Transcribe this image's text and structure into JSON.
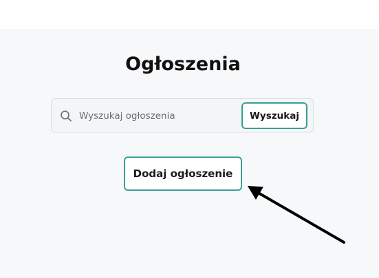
{
  "page": {
    "title": "Ogłoszenia"
  },
  "search": {
    "placeholder": "Wyszukaj ogłoszenia",
    "value": "",
    "button_label": "Wyszukaj"
  },
  "actions": {
    "add_label": "Dodaj ogłoszenie"
  },
  "icons": {
    "search": "search-icon",
    "annotation": "arrow-icon"
  },
  "colors": {
    "accent": "#3a9f94",
    "background": "#f7f8fa",
    "annotation": "#000000"
  }
}
